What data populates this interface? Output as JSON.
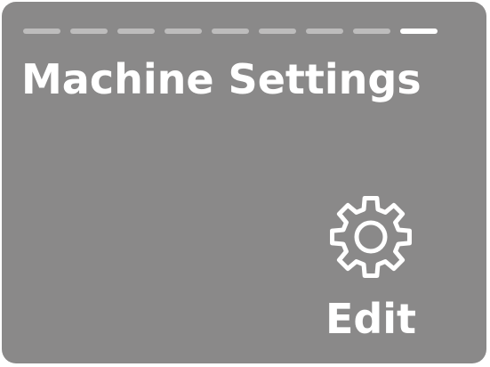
{
  "pager": {
    "total_pages": 9,
    "current_page": 9
  },
  "header": {
    "title": "Machine Settings"
  },
  "action": {
    "icon": "gear-icon",
    "label": "Edit"
  },
  "colors": {
    "background": "#8a8989",
    "foreground": "#ffffff",
    "pager_inactive": "#bdbcbc"
  }
}
